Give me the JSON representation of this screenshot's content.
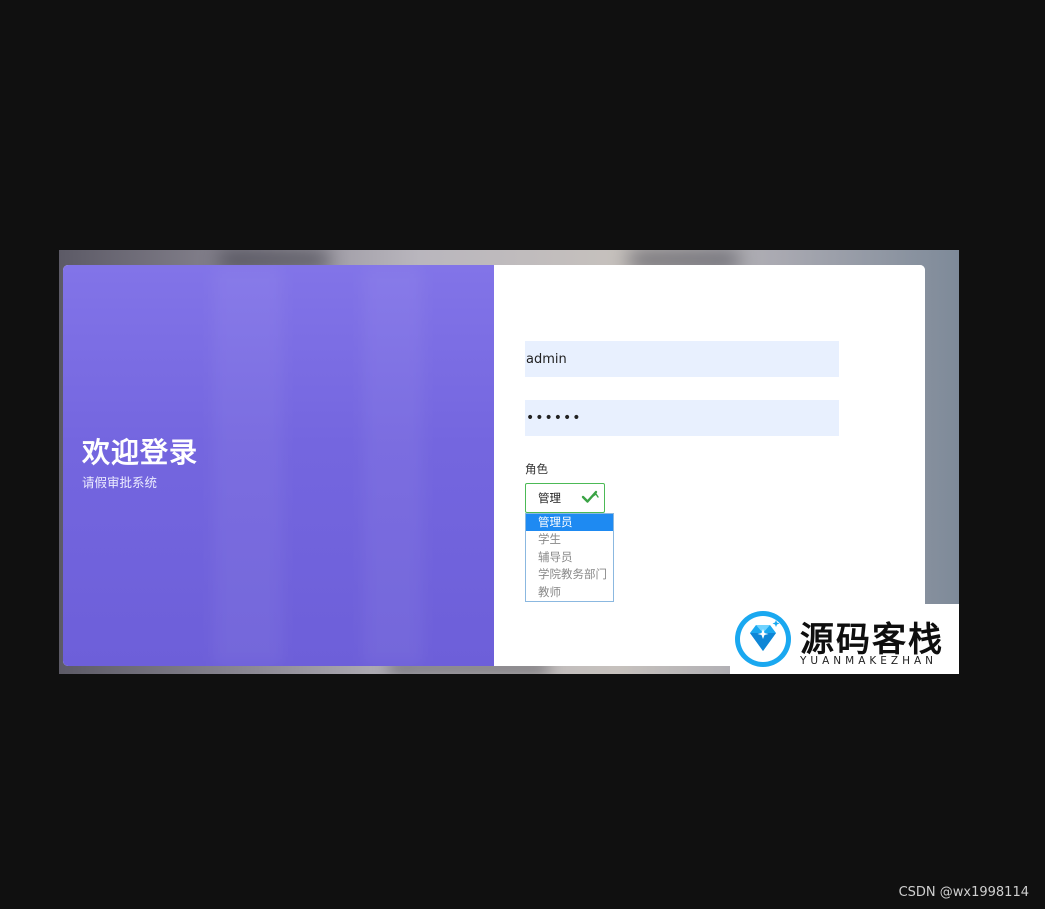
{
  "hero": {
    "title": "欢迎登录",
    "subtitle": "请假审批系统"
  },
  "form": {
    "username_value": "admin",
    "password_value": "••••••",
    "role_label": "角色",
    "role_selected": "管理",
    "role_options": [
      "管理员",
      "学生",
      "辅导员",
      "学院教务部门",
      "教师"
    ],
    "role_highlighted_index": 0
  },
  "badge": {
    "brand_cn": "源码客栈",
    "brand_en": "YUANMAKEZHAN"
  },
  "watermark": "CSDN @wx1998114",
  "colors": {
    "hero_purple": "#7466df",
    "input_bg": "#e8f0fe",
    "select_border": "#4cba56",
    "option_highlight": "#1e8af2"
  },
  "icons": [
    "green-check-icon",
    "diamond-logo-icon"
  ]
}
